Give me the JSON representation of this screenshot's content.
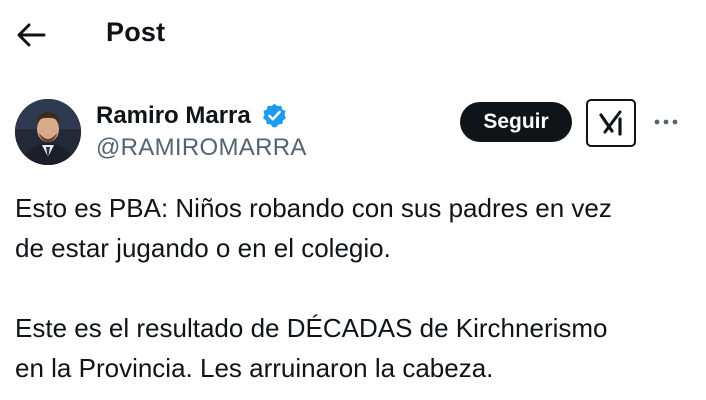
{
  "header": {
    "back_icon": "arrow-left-icon",
    "title": "Post"
  },
  "author": {
    "name": "Ramiro Marra",
    "handle": "@RAMIROMARRA",
    "verified_icon": "verified-badge-icon",
    "verified_color": "#1d9bf0"
  },
  "actions": {
    "follow_label": "Seguir",
    "grok_icon": "grok-icon",
    "more_icon": "more-options-icon"
  },
  "post": {
    "paragraph1_line1": "Esto es PBA: Niños robando con sus padres en vez",
    "paragraph1_line2": "de estar jugando o en el colegio.",
    "paragraph2_line1": "Este es el resultado de DÉCADAS de Kirchnerismo",
    "paragraph2_line2": "en la Provincia. Les arruinaron la cabeza."
  },
  "colors": {
    "text": "#0f1419",
    "secondary_text": "#536471",
    "button_bg": "#0f1419"
  }
}
